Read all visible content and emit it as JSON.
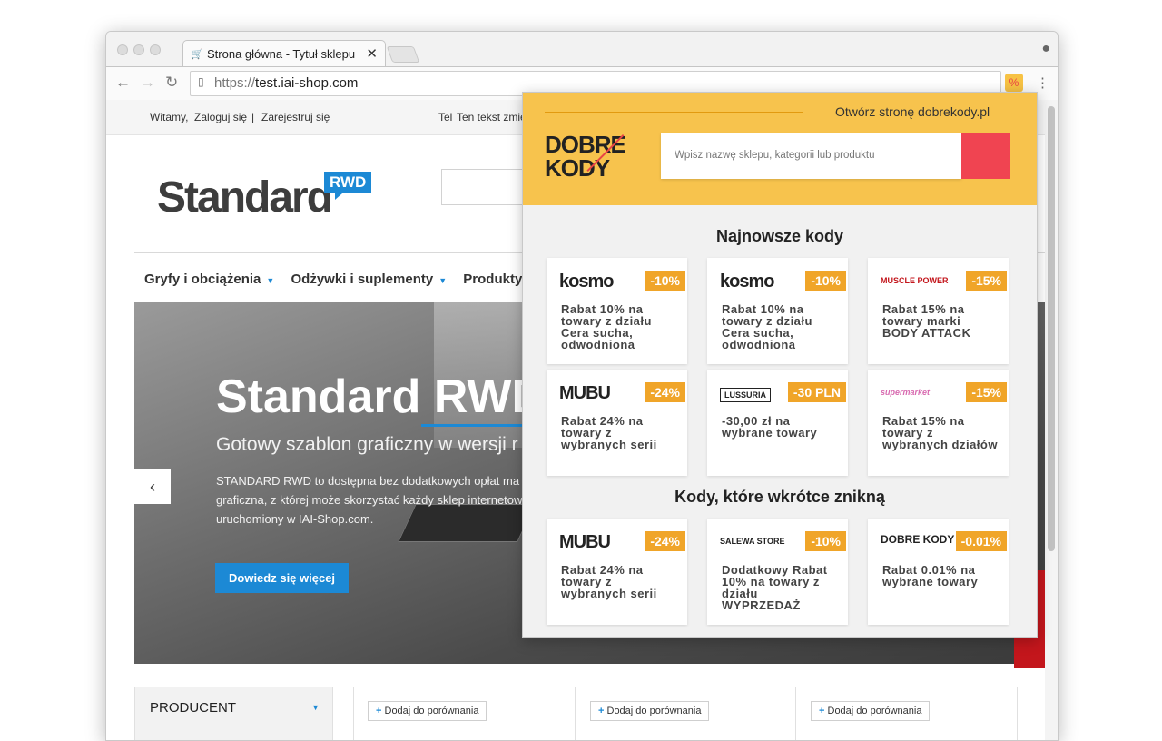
{
  "browser": {
    "tab_title": "Strona główna - Tytuł sklepu z...",
    "tab_icon": "cart-icon",
    "url_scheme": "https://",
    "url_host": "test.iai-shop.com",
    "close_glyph": "✕"
  },
  "shop": {
    "welcome": "Witamy,",
    "login": "Zaloguj się",
    "separator": "|",
    "register": "Zarejestruj się",
    "tel_label": "Tel",
    "tel_text": "Ten tekst zmie",
    "logo": "Standard",
    "logo_badge": "RWD",
    "categories": [
      "Gryfy i obciążenia",
      "Odżywki i suplementy",
      "Produkty g"
    ],
    "hero": {
      "title": "Standard RWD",
      "subtitle": "Gotowy szablon graficzny w wersji r",
      "text": "STANDARD RWD to dostępna bez dodatkowych opłat ma graficzna, z której może skorzystać każdy sklep internetow uruchomiony w IAI-Shop.com.",
      "button": "Dowiedz się więcej",
      "prev": "‹"
    },
    "producer_label": "PRODUCENT",
    "compare_label": "Dodaj do porównania"
  },
  "popup": {
    "open_link": "Otwórz stronę dobrekody.pl",
    "brand_line1": "DOBRE",
    "brand_line2": "KODY",
    "search_placeholder": "Wpisz nazwę sklepu, kategorii lub produktu",
    "section_new": "Najnowsze kody",
    "section_expiring": "Kody, które wkrótce znikną",
    "new_codes": [
      {
        "logo": "kosmo",
        "badge": "-10%",
        "desc": "Rabat 10% na towary z działu Cera sucha, odwodniona"
      },
      {
        "logo": "kosmo",
        "badge": "-10%",
        "desc": "Rabat 10% na towary z działu Cera sucha, odwodniona"
      },
      {
        "logo": "MUSCLE POWER",
        "badge": "-15%",
        "desc": "Rabat 15% na towary marki BODY ATTACK"
      },
      {
        "logo": "MUBU",
        "badge": "-24%",
        "desc": "Rabat 24% na towary z wybranych serii"
      },
      {
        "logo": "LUSSURIA",
        "badge": "-30 PLN",
        "desc": "-30,00 zł na wybrane towary"
      },
      {
        "logo": "supermarket",
        "badge": "-15%",
        "desc": "Rabat 15% na towary z wybranych działów"
      }
    ],
    "expiring_codes": [
      {
        "logo": "MUBU",
        "badge": "-24%",
        "desc": "Rabat 24% na towary z wybranych serii"
      },
      {
        "logo": "SALEWA STORE",
        "badge": "-10%",
        "desc": "Dodatkowy Rabat 10% na towary z działu WYPRZEDAŻ"
      },
      {
        "logo": "DOBRE KODY",
        "badge": "-0.01%",
        "desc": "Rabat 0.01% na wybrane towary"
      }
    ]
  },
  "colors": {
    "accent_blue": "#1c89d5",
    "popup_yellow": "#f7c34d",
    "badge_orange": "#f0a529",
    "search_red": "#f04451"
  }
}
